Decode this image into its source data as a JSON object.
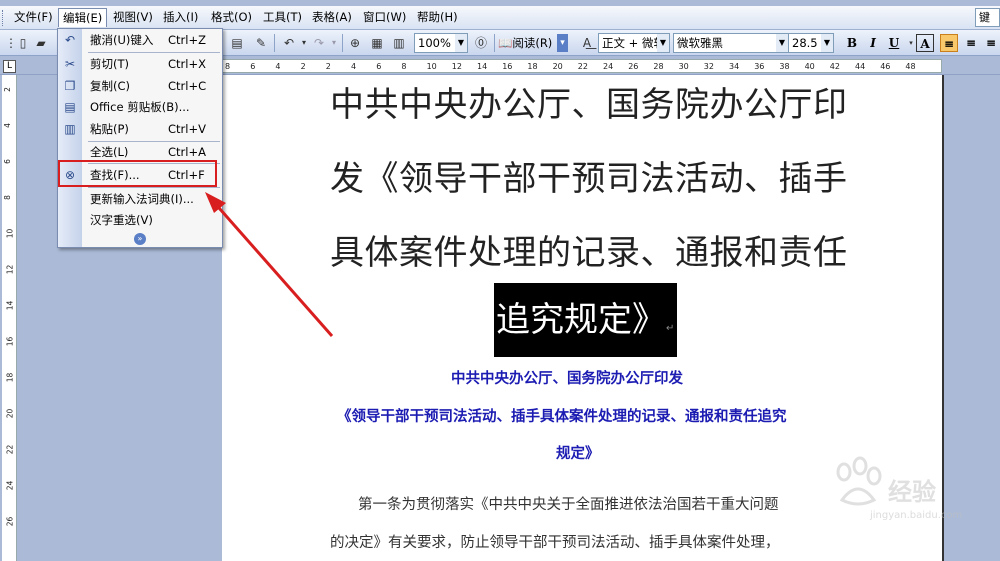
{
  "menubar": {
    "items": [
      "文件(F)",
      "编辑(E)",
      "视图(V)",
      "插入(I)",
      "格式(O)",
      "工具(T)",
      "表格(A)",
      "窗口(W)",
      "帮助(H)"
    ],
    "help_box": "键"
  },
  "toolbar": {
    "zoom": "100%",
    "read_label": "阅读(R)",
    "style": "正文 + 微软",
    "font": "微软雅黑",
    "size": "28.5",
    "bold": "B",
    "italic": "I",
    "underline": "U",
    "font_color": "A"
  },
  "ruler": {
    "corner": "L",
    "numbers": [
      "8",
      "6",
      "4",
      "2",
      "2",
      "4",
      "6",
      "8",
      "10",
      "12",
      "14",
      "16",
      "18",
      "20",
      "22",
      "24",
      "26",
      "28",
      "30",
      "32",
      "34",
      "36",
      "38",
      "40",
      "42",
      "44",
      "46",
      "48"
    ],
    "vnumbers": [
      "2",
      "4",
      "6",
      "8",
      "10",
      "12",
      "14",
      "16",
      "18",
      "20",
      "22",
      "24",
      "26"
    ]
  },
  "edit_menu": {
    "items": [
      {
        "icon": "undo-icon",
        "label": "撤消(U)键入",
        "shortcut": "Ctrl+Z"
      },
      {
        "icon": "cut-icon",
        "label": "剪切(T)",
        "shortcut": "Ctrl+X"
      },
      {
        "icon": "copy-icon",
        "label": "复制(C)",
        "shortcut": "Ctrl+C"
      },
      {
        "icon": "clipboard-icon",
        "label": "Office 剪贴板(B)...",
        "shortcut": ""
      },
      {
        "icon": "paste-icon",
        "label": "粘贴(P)",
        "shortcut": "Ctrl+V"
      },
      {
        "icon": "",
        "label": "全选(L)",
        "shortcut": "Ctrl+A"
      },
      {
        "icon": "binoculars-icon",
        "label": "查找(F)...",
        "shortcut": "Ctrl+F"
      },
      {
        "icon": "",
        "label": "更新输入法词典(I)...",
        "shortcut": ""
      },
      {
        "icon": "",
        "label": "汉字重选(V)",
        "shortcut": ""
      }
    ]
  },
  "document": {
    "title_lines": [
      "中共中央办公厅、国务院办公厅印",
      "发《领导干部干预司法活动、插手",
      "具体案件处理的记录、通报和责任"
    ],
    "title_selected": "追究规定》",
    "paragraph_mark": "↵",
    "subtitle1": "中共中央办公厅、国务院办公厅印发",
    "subtitle2": "《领导干部干预司法活动、插手具体案件处理的记录、通报和责任追究",
    "subtitle3": "规定》",
    "body_line1": "第一条为贯彻落实《中共中央关于全面推进依法治国若干重大问题",
    "body_line2": "的决定》有关要求，防止领导干部干预司法活动、插手具体案件处理，"
  },
  "watermark": {
    "text": "经验",
    "url": "jingyan.baidu.com"
  },
  "colors": {
    "highlight_red": "#d81e1e",
    "subtitle_blue": "#1c1cb3"
  }
}
